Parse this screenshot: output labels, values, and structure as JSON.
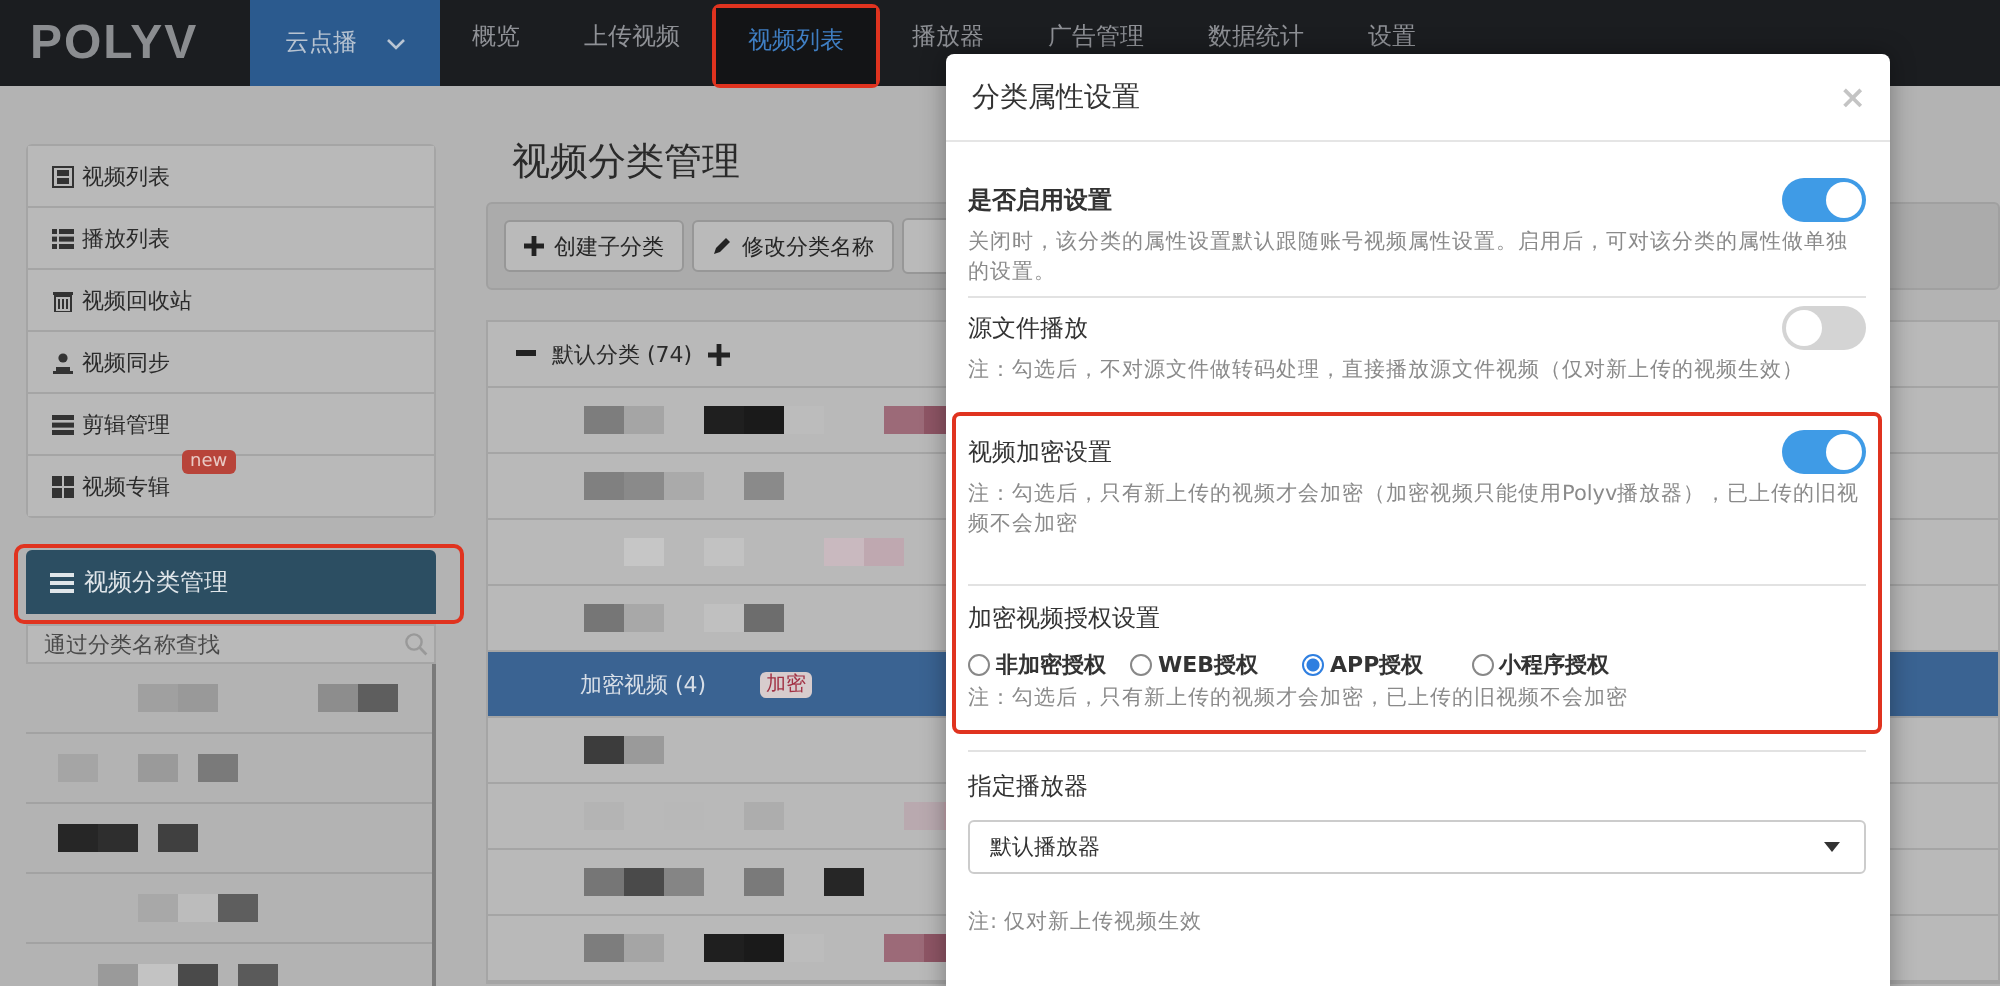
{
  "nav": {
    "logo": "POLYV",
    "product": {
      "label": "云点播"
    },
    "tabs": [
      {
        "label": "概览",
        "selected": false,
        "highlighted": false
      },
      {
        "label": "上传视频",
        "selected": false,
        "highlighted": false
      },
      {
        "label": "视频列表",
        "selected": true,
        "highlighted": true
      },
      {
        "label": "播放器",
        "selected": false,
        "highlighted": false
      },
      {
        "label": "广告管理",
        "selected": false,
        "highlighted": false
      },
      {
        "label": "数据统计",
        "selected": false,
        "highlighted": false
      },
      {
        "label": "设置",
        "selected": false,
        "highlighted": false
      }
    ]
  },
  "sidebar": {
    "items": [
      {
        "label": "视频列表",
        "selected": false
      },
      {
        "label": "播放列表",
        "selected": false
      },
      {
        "label": "视频回收站",
        "selected": false
      },
      {
        "label": "视频同步",
        "selected": false
      },
      {
        "label": "剪辑管理",
        "selected": false
      },
      {
        "label": "视频专辑",
        "selected": false,
        "badge": "new"
      }
    ],
    "category_item": {
      "label": "视频分类管理",
      "selected": true,
      "highlighted": true
    },
    "search": {
      "placeholder": "通过分类名称查找"
    },
    "categories": [
      {
        "kind": "redacted"
      },
      {
        "kind": "redacted"
      },
      {
        "kind": "redacted"
      },
      {
        "kind": "redacted"
      },
      {
        "kind": "redacted"
      }
    ]
  },
  "main": {
    "title": "视频分类管理",
    "toolbar": [
      {
        "label": "创建子分类"
      },
      {
        "label": "修改分类名称"
      }
    ],
    "tree": {
      "root": {
        "label": "默认分类 (74)",
        "expanded": true
      },
      "rows": [
        {
          "kind": "redacted",
          "selected": false
        },
        {
          "kind": "redacted",
          "selected": false
        },
        {
          "kind": "redacted",
          "selected": false
        },
        {
          "kind": "redacted",
          "selected": false
        },
        {
          "kind": "category",
          "label": "加密视频 (4)",
          "badge": "加密",
          "selected": true
        },
        {
          "kind": "redacted",
          "selected": false
        },
        {
          "kind": "redacted",
          "selected": false
        },
        {
          "kind": "redacted",
          "selected": false
        },
        {
          "kind": "redacted",
          "selected": false
        }
      ]
    }
  },
  "modal": {
    "title": "分类属性设置",
    "close": "×",
    "enable": {
      "label": "是否启用设置",
      "on": true,
      "description": "关闭时，该分类的属性设置默认跟随账号视频属性设置。启用后，可对该分类的属性做单独的设置。"
    },
    "source_play": {
      "label": "源文件播放",
      "on": false,
      "note": "注：勾选后，不对源文件做转码处理，直接播放源文件视频（仅对新上传的视频生效）"
    },
    "encryption": {
      "highlighted": true,
      "label": "视频加密设置",
      "on": true,
      "note": "注：勾选后，只有新上传的视频才会加密（加密视频只能使用Polyv播放器），已上传的旧视频不会加密",
      "auth_label": "加密视频授权设置",
      "auth_options": [
        {
          "label": "非加密授权",
          "selected": false
        },
        {
          "label": "WEB授权",
          "selected": false
        },
        {
          "label": "APP授权",
          "selected": true
        },
        {
          "label": "小程序授权",
          "selected": false
        }
      ],
      "auth_note": "注：勾选后，只有新上传的视频才会加密，已上传的旧视频不会加密"
    },
    "player": {
      "label": "指定播放器",
      "value": "默认播放器",
      "note": "注: 仅对新上传视频生效"
    }
  }
}
